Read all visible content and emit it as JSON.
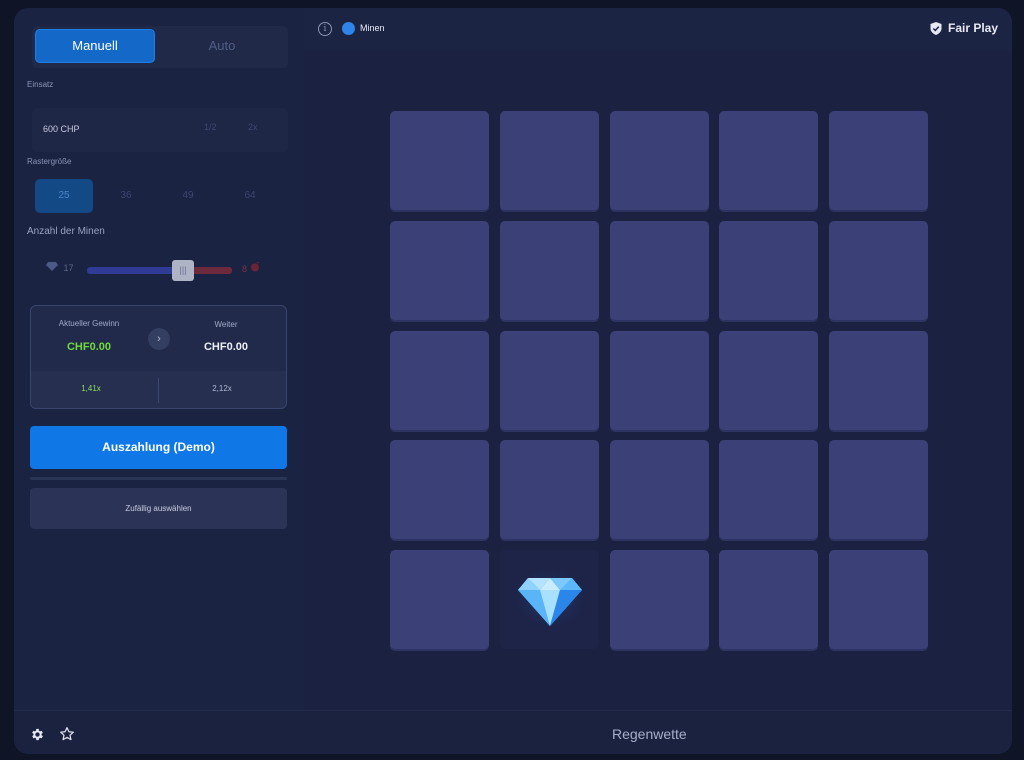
{
  "sidebar": {
    "tabs": [
      {
        "label": "Manuell",
        "active": true
      },
      {
        "label": "Auto",
        "active": false
      }
    ],
    "stake": {
      "label": "Einsatz",
      "value": "600 CHP",
      "half_label": "1/2",
      "double_label": "2x"
    },
    "grid_size": {
      "label": "Rastergröße",
      "options": [
        "25",
        "36",
        "49",
        "64"
      ],
      "selected": "25"
    },
    "mines": {
      "label": "Anzahl der Minen",
      "gems_count": "17",
      "knob_label": "|||",
      "mines_count": "8"
    },
    "winnings": {
      "current_label": "Aktueller Gewinn",
      "current_value": "CHF0.00",
      "next_label": "Weiter",
      "next_value": "CHF0.00",
      "current_multiplier": "1,41x",
      "next_multiplier": "2,12x"
    },
    "cashout_label": "Auszahlung (Demo)",
    "random_label": "Zufällig auswählen"
  },
  "topbar": {
    "info_icon": "info-icon",
    "game_name": "Minen",
    "fair_play_label": "Fair Play"
  },
  "board": {
    "rows": 5,
    "cols": 5,
    "revealed": [
      {
        "row": 5,
        "col": 2,
        "content": "diamond"
      }
    ]
  },
  "bottombar": {
    "settings_icon": "gear-icon",
    "favorite_icon": "star-icon",
    "bet_name": "Regenwette"
  },
  "colors": {
    "accent": "#0f78e6",
    "tile": "#3b4176",
    "win_green": "#6fdc3a",
    "panel": "#1b2342"
  }
}
